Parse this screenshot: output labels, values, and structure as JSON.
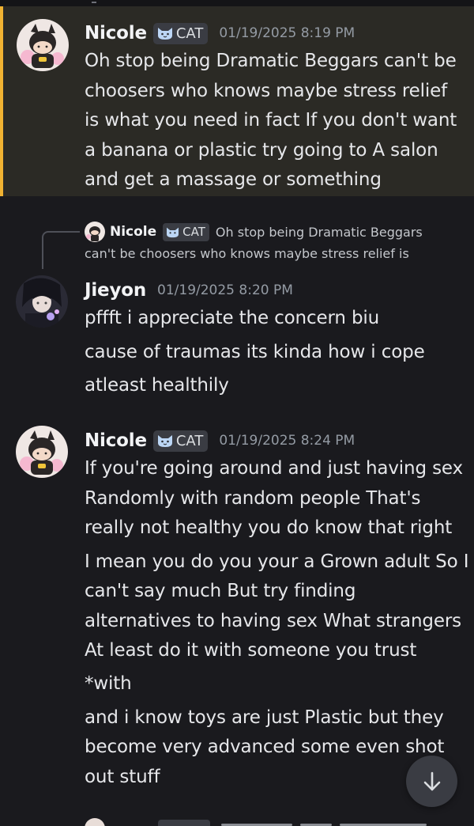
{
  "messages": [
    {
      "author": "Nicole",
      "tag": "CAT",
      "timestamp": "01/19/2025 8:19 PM",
      "lines": [
        "Oh stop being Dramatic Beggars can't be",
        "choosers who knows maybe stress relief",
        "is what you need in fact If you don't want",
        "a banana or plastic try going to A salon",
        "and get a massage or something"
      ]
    },
    {
      "author": "Jieyon",
      "timestamp": "01/19/2025 8:20 PM",
      "reply": {
        "author": "Nicole",
        "tag": "CAT",
        "text_line1": "Oh stop being Dramatic Beggars",
        "text_line2": "can't be choosers who knows maybe stress relief is"
      },
      "lines": [
        "pffft i appreciate the concern biu",
        "cause of traumas its kinda how i cope",
        "atleast healthily"
      ]
    },
    {
      "author": "Nicole",
      "tag": "CAT",
      "timestamp": "01/19/2025 8:24 PM",
      "lines": [
        "If you're going around and just having sex",
        "Randomly with random people That's",
        "really not healthy you do know that right",
        "I mean you do you your a Grown adult So I",
        "can't say much But try finding",
        "alternatives to having sex What strangers",
        "At least do it with someone you trust",
        "*with",
        "and i know toys are just Plastic but they",
        "become very advanced some even shot",
        "out stuff"
      ]
    }
  ],
  "icons": {
    "scroll_button": "arrow-down-icon",
    "tag_icon": "cat-face-icon"
  },
  "colors": {
    "background": "#1a1a1e",
    "highlight_bg": "#2b2a25",
    "highlight_bar": "#f0b232",
    "tag_bg": "#3a3c43",
    "timestamp": "#949ba4"
  }
}
